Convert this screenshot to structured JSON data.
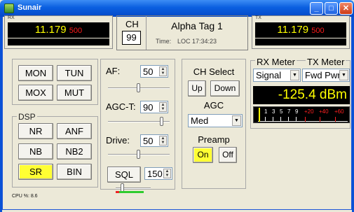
{
  "window": {
    "title": "Sunair",
    "min_symbol": "_",
    "max_symbol": "□",
    "close_symbol": "✕"
  },
  "rx": {
    "caption": "RX",
    "freq_main": "11.179",
    "freq_sub": "500"
  },
  "tx": {
    "caption": "TX",
    "freq_main": "11.179",
    "freq_sub": "500"
  },
  "channel": {
    "label": "CH",
    "number": "99",
    "alpha_tag": "Alpha Tag 1",
    "time_label": "Time:",
    "time_value": "LOC  17:34:23"
  },
  "controls": {
    "mon": "MON",
    "tun": "TUN",
    "mox": "MOX",
    "mut": "MUT"
  },
  "dsp": {
    "label": "DSP",
    "nr": "NR",
    "anf": "ANF",
    "nb": "NB",
    "nb2": "NB2",
    "sr": "SR",
    "bin": "BIN"
  },
  "af": {
    "label": "AF:",
    "value": "50",
    "level": 0.5
  },
  "agc_t": {
    "label": "AGC-T:",
    "value": "90",
    "level": 0.9
  },
  "drive": {
    "label": "Drive:",
    "value": "50",
    "level": 0.5
  },
  "sql": {
    "label": "SQL",
    "value": "150",
    "level": 0.15
  },
  "ch_select": {
    "label": "CH Select",
    "up": "Up",
    "down": "Down"
  },
  "agc": {
    "label": "AGC",
    "value": "Med"
  },
  "preamp": {
    "label": "Preamp",
    "on": "On",
    "off": "Off"
  },
  "meters": {
    "rx_label": "RX Meter",
    "tx_label": "TX Meter",
    "rx_select": "Signal",
    "tx_select": "Fwd Pwr",
    "dbm_reading": "-125.4 dBm",
    "scale": [
      {
        "t": "1",
        "c": "#ffffff"
      },
      {
        "t": "3",
        "c": "#ffffff"
      },
      {
        "t": "5",
        "c": "#ffffff"
      },
      {
        "t": "7",
        "c": "#ffffff"
      },
      {
        "t": "9",
        "c": "#ffffff"
      },
      {
        "t": "+20",
        "c": "#ff2020"
      },
      {
        "t": "+40",
        "c": "#ff2020"
      },
      {
        "t": "+60",
        "c": "#ff2020"
      }
    ]
  },
  "status": {
    "cpu": "CPU %: 8.6"
  },
  "colors": {
    "display_bg": "#000000",
    "freq_text": "#ffff00",
    "freq_sub": "#ff1a1a",
    "active_button": "#ffff33",
    "title_bar": "#0a5fe0"
  }
}
